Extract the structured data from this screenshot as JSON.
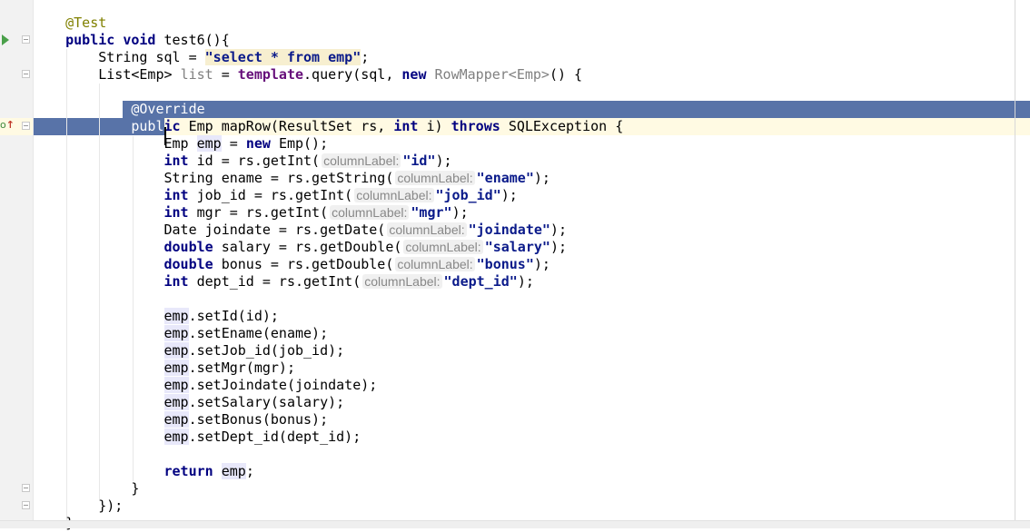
{
  "editor": {
    "current_line": 6,
    "gutter_icons": {
      "run": "run-test-icon",
      "override": "override-method-icon",
      "fold": "fold-marker-icon"
    },
    "colors": {
      "selection": "#5873a8",
      "current_line": "#fffae3",
      "keyword": "#000080",
      "annotation": "#808000",
      "field": "#660e7a"
    },
    "lines": [
      [
        [
          "t",
          "    "
        ],
        [
          "ann",
          "@Test"
        ]
      ],
      [
        [
          "t",
          "    "
        ],
        [
          "kw",
          "public void "
        ],
        [
          "t",
          "test6(){"
        ]
      ],
      [
        [
          "t",
          "        String sql = "
        ],
        [
          "sqlstr",
          "\"select * from emp\""
        ],
        [
          "t",
          ";"
        ]
      ],
      [
        [
          "t",
          "        List<Emp> "
        ],
        [
          "unused",
          "list"
        ],
        [
          "t",
          " = "
        ],
        [
          "field",
          "template"
        ],
        [
          "t",
          ".query(sql, "
        ],
        [
          "kw",
          "new "
        ],
        [
          "unused",
          "RowMapper<Emp>"
        ],
        [
          "t",
          "() {"
        ]
      ],
      [],
      [
        [
          "t",
          "           "
        ],
        [
          "sel",
          " @Override"
        ]
      ],
      [
        [
          "sel",
          "            publ"
        ],
        [
          "kw",
          "ic "
        ],
        [
          "t",
          "Emp mapRow(ResultSet rs, "
        ],
        [
          "kw",
          "int "
        ],
        [
          "t",
          "i) "
        ],
        [
          "kw",
          "throws "
        ],
        [
          "t",
          "SQLException {"
        ]
      ],
      [
        [
          "t",
          "                Emp "
        ],
        [
          "var",
          "emp"
        ],
        [
          "t",
          " = "
        ],
        [
          "kw",
          "new "
        ],
        [
          "t",
          "Emp();"
        ]
      ],
      [
        [
          "t",
          "                "
        ],
        [
          "kw",
          "int "
        ],
        [
          "t",
          "id = rs.getInt("
        ],
        [
          "hint",
          "columnLabel:"
        ],
        [
          "str",
          "\"id\""
        ],
        [
          "t",
          ");"
        ]
      ],
      [
        [
          "t",
          "                String ename = rs.getString("
        ],
        [
          "hint",
          "columnLabel:"
        ],
        [
          "str",
          "\"ename\""
        ],
        [
          "t",
          ");"
        ]
      ],
      [
        [
          "t",
          "                "
        ],
        [
          "kw",
          "int "
        ],
        [
          "t",
          "job_id = rs.getInt("
        ],
        [
          "hint",
          "columnLabel:"
        ],
        [
          "str",
          "\"job_id\""
        ],
        [
          "t",
          ");"
        ]
      ],
      [
        [
          "t",
          "                "
        ],
        [
          "kw",
          "int "
        ],
        [
          "t",
          "mgr = rs.getInt("
        ],
        [
          "hint",
          "columnLabel:"
        ],
        [
          "str",
          "\"mgr\""
        ],
        [
          "t",
          ");"
        ]
      ],
      [
        [
          "t",
          "                Date joindate = rs.getDate("
        ],
        [
          "hint",
          "columnLabel:"
        ],
        [
          "str",
          "\"joindate\""
        ],
        [
          "t",
          ");"
        ]
      ],
      [
        [
          "t",
          "                "
        ],
        [
          "kw",
          "double "
        ],
        [
          "t",
          "salary = rs.getDouble("
        ],
        [
          "hint",
          "columnLabel:"
        ],
        [
          "str",
          "\"salary\""
        ],
        [
          "t",
          ");"
        ]
      ],
      [
        [
          "t",
          "                "
        ],
        [
          "kw",
          "double "
        ],
        [
          "t",
          "bonus = rs.getDouble("
        ],
        [
          "hint",
          "columnLabel:"
        ],
        [
          "str",
          "\"bonus\""
        ],
        [
          "t",
          ");"
        ]
      ],
      [
        [
          "t",
          "                "
        ],
        [
          "kw",
          "int "
        ],
        [
          "t",
          "dept_id = rs.getInt("
        ],
        [
          "hint",
          "columnLabel:"
        ],
        [
          "str",
          "\"dept_id\""
        ],
        [
          "t",
          ");"
        ]
      ],
      [],
      [
        [
          "t",
          "                "
        ],
        [
          "var",
          "emp"
        ],
        [
          "t",
          ".setId(id);"
        ]
      ],
      [
        [
          "t",
          "                "
        ],
        [
          "var",
          "emp"
        ],
        [
          "t",
          ".setEname(ename);"
        ]
      ],
      [
        [
          "t",
          "                "
        ],
        [
          "var",
          "emp"
        ],
        [
          "t",
          ".setJob_id(job_id);"
        ]
      ],
      [
        [
          "t",
          "                "
        ],
        [
          "var",
          "emp"
        ],
        [
          "t",
          ".setMgr(mgr);"
        ]
      ],
      [
        [
          "t",
          "                "
        ],
        [
          "var",
          "emp"
        ],
        [
          "t",
          ".setJoindate(joindate);"
        ]
      ],
      [
        [
          "t",
          "                "
        ],
        [
          "var",
          "emp"
        ],
        [
          "t",
          ".setSalary(salary);"
        ]
      ],
      [
        [
          "t",
          "                "
        ],
        [
          "var",
          "emp"
        ],
        [
          "t",
          ".setBonus(bonus);"
        ]
      ],
      [
        [
          "t",
          "                "
        ],
        [
          "var",
          "emp"
        ],
        [
          "t",
          ".setDept_id(dept_id);"
        ]
      ],
      [],
      [
        [
          "t",
          "                "
        ],
        [
          "kw",
          "return "
        ],
        [
          "var",
          "emp"
        ],
        [
          "t",
          ";"
        ]
      ],
      [
        [
          "t",
          "            }"
        ]
      ],
      [
        [
          "t",
          "        });"
        ]
      ],
      [
        [
          "t",
          "    }"
        ]
      ]
    ]
  }
}
